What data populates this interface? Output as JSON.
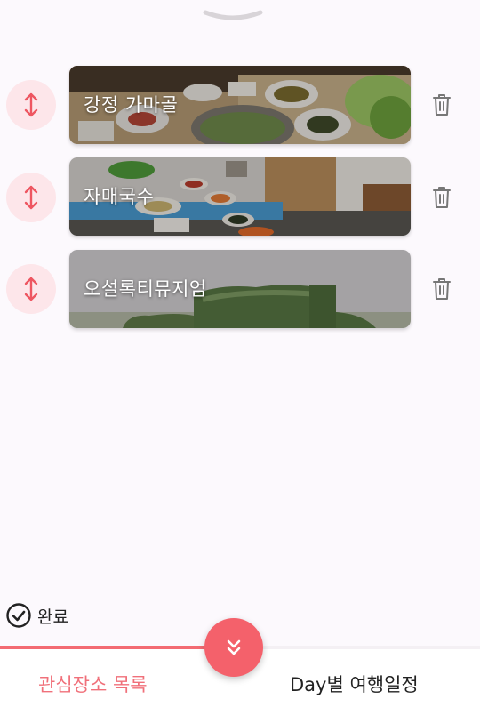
{
  "places": [
    {
      "name": "강정 가마골",
      "image": "korean-bbq-table-photo"
    },
    {
      "name": "자매국수",
      "image": "banchan-buffet-table-photo"
    },
    {
      "name": "오설록티뮤지엄",
      "image": "tea-museum-hedge-photo"
    }
  ],
  "complete": {
    "label": "완료",
    "icon": "check-circle-icon"
  },
  "tabs": {
    "left": "관심장소 목록",
    "right": "Day별 여행일정"
  },
  "progress": {
    "fraction": 0.44
  },
  "colors": {
    "accent": "#f4616b",
    "accent_soft": "#fde6ea",
    "tab_active": "#f0707a",
    "background": "#fcf9fd"
  }
}
